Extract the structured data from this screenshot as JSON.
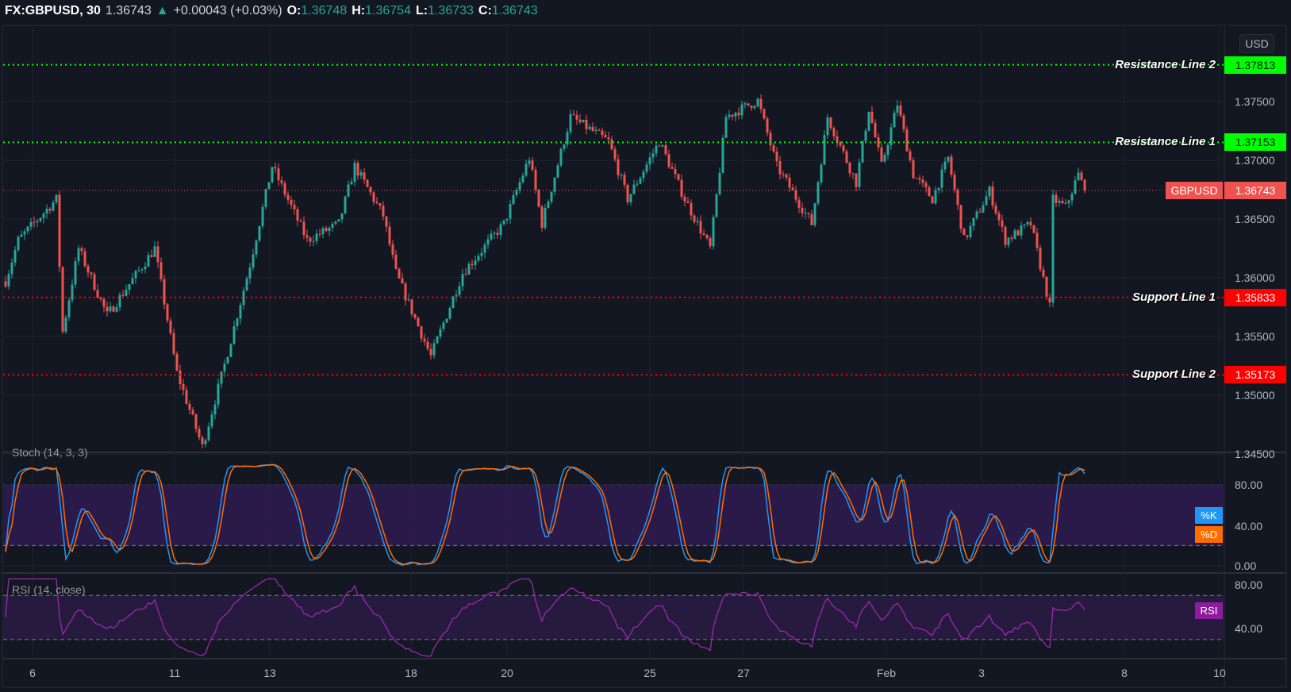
{
  "header": {
    "symbol": "FX:GBPUSD, 30",
    "last": "1.36743",
    "change": "+0.00043 (+0.03%)",
    "o_label": "O:",
    "o": "1.36748",
    "h_label": "H:",
    "h": "1.36754",
    "l_label": "L:",
    "l": "1.36733",
    "c_label": "C:",
    "c": "1.36743"
  },
  "currency_button": "USD",
  "colors": {
    "bg": "#131722",
    "up": "#26a69a",
    "down": "#ef5350",
    "resistance": "#00ff00",
    "support": "#ff0000",
    "stoch_k": "#2196f3",
    "stoch_d": "#ff6d00",
    "rsi": "#9c27b0"
  },
  "price_tag": {
    "label": "GBPUSD",
    "value": "1.36743"
  },
  "levels": [
    {
      "label": "Resistance Line 2",
      "value": "1.37813",
      "price": 1.37813,
      "type": "resistance"
    },
    {
      "label": "Resistance Line 1",
      "value": "1.37153",
      "price": 1.37153,
      "type": "resistance"
    },
    {
      "label": "Support Line 1",
      "value": "1.35833",
      "price": 1.35833,
      "type": "support"
    },
    {
      "label": "Support Line 2",
      "value": "1.35173",
      "price": 1.35173,
      "type": "support"
    }
  ],
  "stoch": {
    "title": "Stoch (14, 3, 3)",
    "k_label": "%K",
    "d_label": "%D",
    "ticks": [
      "80.00",
      "40.00",
      "0.00"
    ],
    "upper": 80,
    "lower": 20
  },
  "rsi": {
    "title": "RSI (14, close)",
    "label": "RSI",
    "ticks": [
      "80.00",
      "40.00"
    ],
    "upper": 70,
    "lower": 30
  },
  "chart_data": {
    "type": "candlestick",
    "symbol": "GBPUSD",
    "interval": "30",
    "ylim": [
      1.345,
      1.38
    ],
    "y_ticks": [
      "1.37500",
      "1.37000",
      "1.36500",
      "1.36000",
      "1.35500",
      "1.35000",
      "1.34500"
    ],
    "x_ticks": [
      {
        "label": "6",
        "bar": 8.5
      },
      {
        "label": "11",
        "bar": 53.25
      },
      {
        "label": "13",
        "bar": 83.25
      },
      {
        "label": "18",
        "bar": 127.75
      },
      {
        "label": "20",
        "bar": 158
      },
      {
        "label": "25",
        "bar": 203
      },
      {
        "label": "27",
        "bar": 232.5
      },
      {
        "label": "Feb",
        "bar": 277.5
      },
      {
        "label": "3",
        "bar": 307.5
      },
      {
        "label": "8",
        "bar": 352.5
      },
      {
        "label": "10",
        "bar": 382.5
      }
    ],
    "close_keyframes": [
      [
        0,
        1.3597
      ],
      [
        4,
        1.3632
      ],
      [
        16,
        1.3667
      ],
      [
        18,
        1.3554
      ],
      [
        23,
        1.3625
      ],
      [
        32,
        1.3568
      ],
      [
        47,
        1.3625
      ],
      [
        54,
        1.3519
      ],
      [
        62,
        1.3456
      ],
      [
        69,
        1.3526
      ],
      [
        77,
        1.3611
      ],
      [
        84,
        1.3695
      ],
      [
        95,
        1.3632
      ],
      [
        105,
        1.3646
      ],
      [
        110,
        1.3695
      ],
      [
        119,
        1.3653
      ],
      [
        123,
        1.3604
      ],
      [
        134,
        1.3533
      ],
      [
        144,
        1.3604
      ],
      [
        157,
        1.3646
      ],
      [
        165,
        1.3702
      ],
      [
        169,
        1.3646
      ],
      [
        178,
        1.3737
      ],
      [
        190,
        1.3716
      ],
      [
        196,
        1.3667
      ],
      [
        206,
        1.3716
      ],
      [
        214,
        1.3667
      ],
      [
        222,
        1.3625
      ],
      [
        227,
        1.3737
      ],
      [
        237,
        1.3751
      ],
      [
        243,
        1.3695
      ],
      [
        254,
        1.3646
      ],
      [
        259,
        1.3737
      ],
      [
        268,
        1.3681
      ],
      [
        272,
        1.3744
      ],
      [
        276,
        1.3695
      ],
      [
        281,
        1.3748
      ],
      [
        286,
        1.3688
      ],
      [
        292,
        1.3667
      ],
      [
        297,
        1.3702
      ],
      [
        302,
        1.3632
      ],
      [
        310,
        1.3674
      ],
      [
        315,
        1.3632
      ],
      [
        323,
        1.3646
      ],
      [
        329,
        1.3575
      ],
      [
        330,
        1.3667
      ],
      [
        334,
        1.366
      ],
      [
        338,
        1.3688
      ],
      [
        340,
        1.36743
      ]
    ]
  }
}
